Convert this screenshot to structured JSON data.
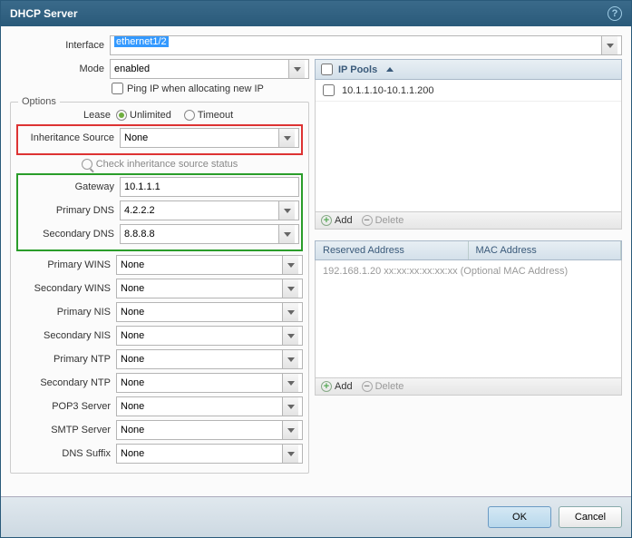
{
  "title": "DHCP Server",
  "labels": {
    "interface": "Interface",
    "mode": "Mode",
    "pingIp": "Ping IP when allocating new IP",
    "options": "Options",
    "lease": "Lease",
    "unlimited": "Unlimited",
    "timeout": "Timeout",
    "inheritanceSource": "Inheritance Source",
    "checkInherit": "Check inheritance source status",
    "gateway": "Gateway",
    "primaryDns": "Primary DNS",
    "secondaryDns": "Secondary DNS",
    "primaryWins": "Primary WINS",
    "secondaryWins": "Secondary WINS",
    "primaryNis": "Primary NIS",
    "secondaryNis": "Secondary NIS",
    "primaryNtp": "Primary NTP",
    "secondaryNtp": "Secondary NTP",
    "pop3": "POP3 Server",
    "smtp": "SMTP Server",
    "dnsSuffix": "DNS Suffix",
    "ipPools": "IP Pools",
    "add": "Add",
    "delete": "Delete",
    "reservedAddress": "Reserved Address",
    "macAddress": "MAC Address",
    "ok": "OK",
    "cancel": "Cancel"
  },
  "values": {
    "interface": "ethernet1/2",
    "mode": "enabled",
    "inheritanceSource": "None",
    "gateway": "10.1.1.1",
    "primaryDns": "4.2.2.2",
    "secondaryDns": "8.8.8.8",
    "primaryWins": "None",
    "secondaryWins": "None",
    "primaryNis": "None",
    "secondaryNis": "None",
    "primaryNtp": "None",
    "secondaryNtp": "None",
    "pop3": "None",
    "smtp": "None",
    "dnsSuffix": "None"
  },
  "ipPools": [
    "10.1.1.10-10.1.1.200"
  ],
  "reservedPlaceholder": "192.168.1.20 xx:xx:xx:xx:xx:xx (Optional MAC Address)"
}
